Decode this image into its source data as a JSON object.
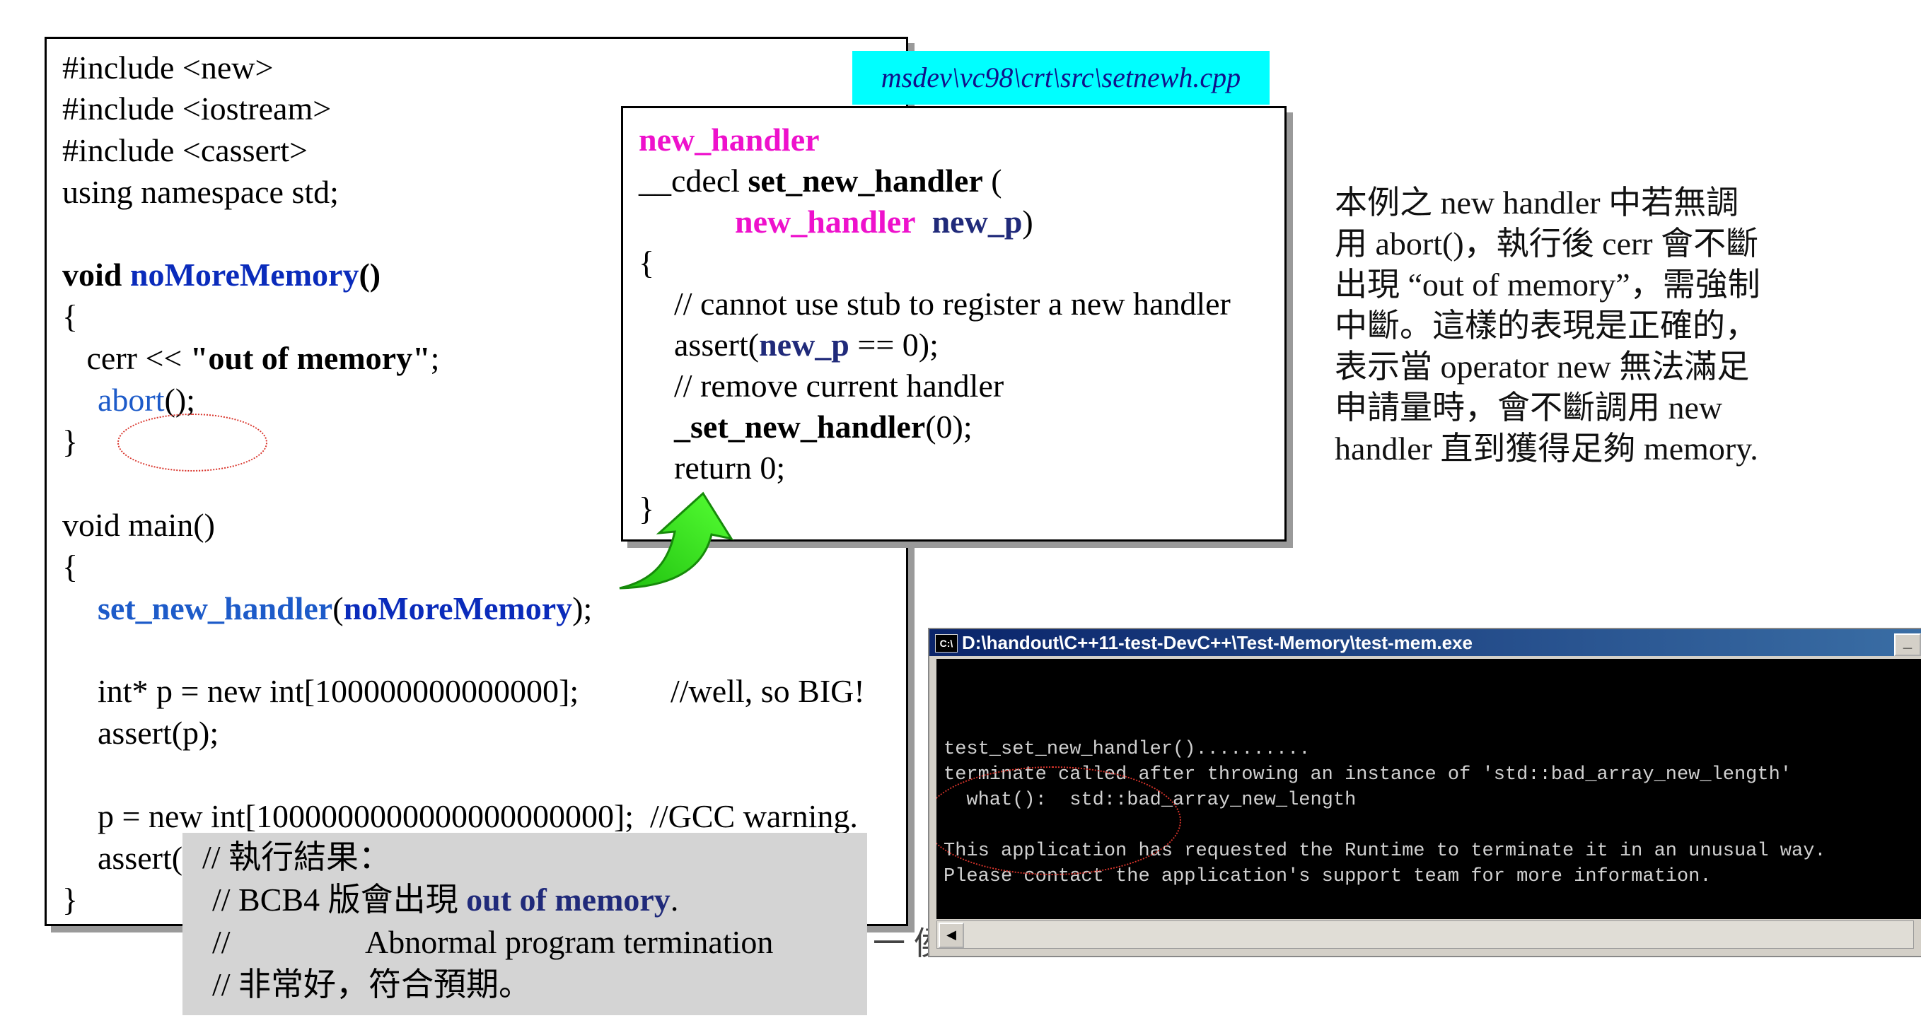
{
  "file_label": "msdev\\vc98\\crt\\src\\setnewh.cpp",
  "main_code": {
    "l1": "#include <new>",
    "l2": "#include <iostream>",
    "l3": "#include <cassert>",
    "l4": "using namespace std;",
    "l5_kw": "void ",
    "l5_fn": "noMoreMemory",
    "l5_end": "()",
    "l6": "{",
    "l7_pre": "   cerr << ",
    "l7_str": "\"out of memory\"",
    "l7_end": ";",
    "l8_fn": "abort",
    "l8_end": "();",
    "l9": "}",
    "l10": "void main()",
    "l11": "{",
    "l12_fn": "set_new_handler",
    "l12_open": "(",
    "l12_arg": "noMoreMemory",
    "l12_end": ");",
    "l13_code": "int* p = new int[100000000000000];",
    "l13_comment": "//well, so BIG!",
    "l14": "assert(p);",
    "l15": "p = new int[1000000000000000000000];  //GCC warning.",
    "l16": "assert(",
    "l17": "}"
  },
  "handler_code": {
    "l1": "new_handler",
    "l2_pre": "__cdecl ",
    "l2_fn": "set_new_handler",
    "l2_end": " (",
    "l3_type": "new_handler",
    "l3_arg": "new_p",
    "l3_end": ")",
    "l4": "{",
    "l5": "// cannot use stub to register a new handler",
    "l6_pre": "assert(",
    "l6_arg": "new_p",
    "l6_end": " == 0);",
    "l7": "// remove current handler",
    "l8_fn": "_set_new_handler",
    "l8_end": "(0);",
    "l9": "return 0;",
    "l10": "}"
  },
  "result_box": {
    "l1": "// 執行結果：",
    "l2_pre": "// BCB4 版會出現 ",
    "l2_hl": "out of memory",
    "l2_end": ".",
    "l3_pre": "//",
    "l3_text": "Abnormal program termination",
    "l4": "// 非常好，符合預期。"
  },
  "partial_text": "一 侯",
  "description": {
    "l1": "本例之 new handler 中若無調",
    "l2": "用 abort()，執行後 cerr 會不斷",
    "l3": "出現 “out of memory”，需強制",
    "l4": "中斷。這樣的表現是正確的，",
    "l5": "表示當 operator new 無法滿足",
    "l6": "申請量時，會不斷調用 new",
    "l7": "handler 直到獲得足夠 memory."
  },
  "console": {
    "icon": "C:\\",
    "title": "D:\\handout\\C++11-test-DevC++\\Test-Memory\\test-mem.exe",
    "min_button": "_",
    "lines": [
      "test_set_new_handler()..........",
      "terminate called after throwing an instance of 'std::bad_array_new_length'",
      "  what():  std::bad_array_new_length",
      "",
      "This application has requested the Runtime to terminate it in an unusual way.",
      "Please contact the application's support team for more information."
    ],
    "scroll_left": "◀"
  },
  "colors": {
    "accent_blue": "#0a2bbb",
    "magenta": "#ee11cc",
    "cyan_label": "#00ffff",
    "arrow_green": "#22dd11"
  }
}
